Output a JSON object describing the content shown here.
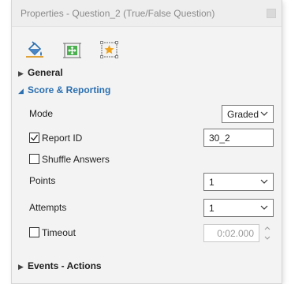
{
  "window": {
    "title": "Properties - Question_2 (True/False Question)"
  },
  "toolbar": {
    "icons": [
      "paint-bucket-icon",
      "move-frame-icon",
      "star-frame-icon"
    ]
  },
  "sections": {
    "general": "General",
    "score": "Score & Reporting",
    "events": "Events - Actions"
  },
  "fields": {
    "mode_label": "Mode",
    "mode_value": "Graded",
    "report_id_label": "Report ID",
    "report_id_checked": true,
    "report_id_value": "30_2",
    "shuffle_label": "Shuffle Answers",
    "shuffle_checked": false,
    "points_label": "Points",
    "points_value": "1",
    "attempts_label": "Attempts",
    "attempts_value": "1",
    "timeout_label": "Timeout",
    "timeout_checked": false,
    "timeout_value": "0:02.000"
  },
  "colors": {
    "accent": "#2a6fb0",
    "panel_bg": "#f3f3f3"
  }
}
